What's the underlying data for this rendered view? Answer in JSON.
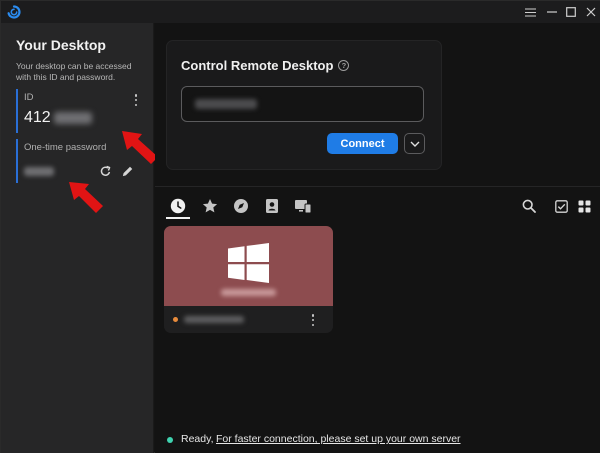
{
  "titlebar": {
    "logo_icon": "rustdesk-logo-icon",
    "controls": [
      "menu-icon",
      "minimize-icon",
      "maximize-icon",
      "close-icon"
    ]
  },
  "left_panel": {
    "title": "Your Desktop",
    "description": "Your desktop can be accessed with this ID and password.",
    "id_label": "ID",
    "id_prefix": "412",
    "password_label": "One-time password"
  },
  "remote": {
    "title": "Control Remote Desktop",
    "connect_label": "Connect",
    "accent": "#1f7ce6"
  },
  "tabs": [
    "recent-sessions-icon",
    "favorites-icon",
    "discovered-icon",
    "address-book-icon",
    "group-icon"
  ],
  "toolbar_right": [
    "search-icon",
    "select-icon",
    "grid-view-icon"
  ],
  "peer_tile": {
    "thumbnail_color": "#8d4c4f",
    "os_icon": "windows-icon",
    "status_color": "#e88b3c"
  },
  "status": {
    "ready": "Ready,",
    "link": "For faster connection, please set up your own server",
    "dot_color": "#3fd3b0"
  }
}
